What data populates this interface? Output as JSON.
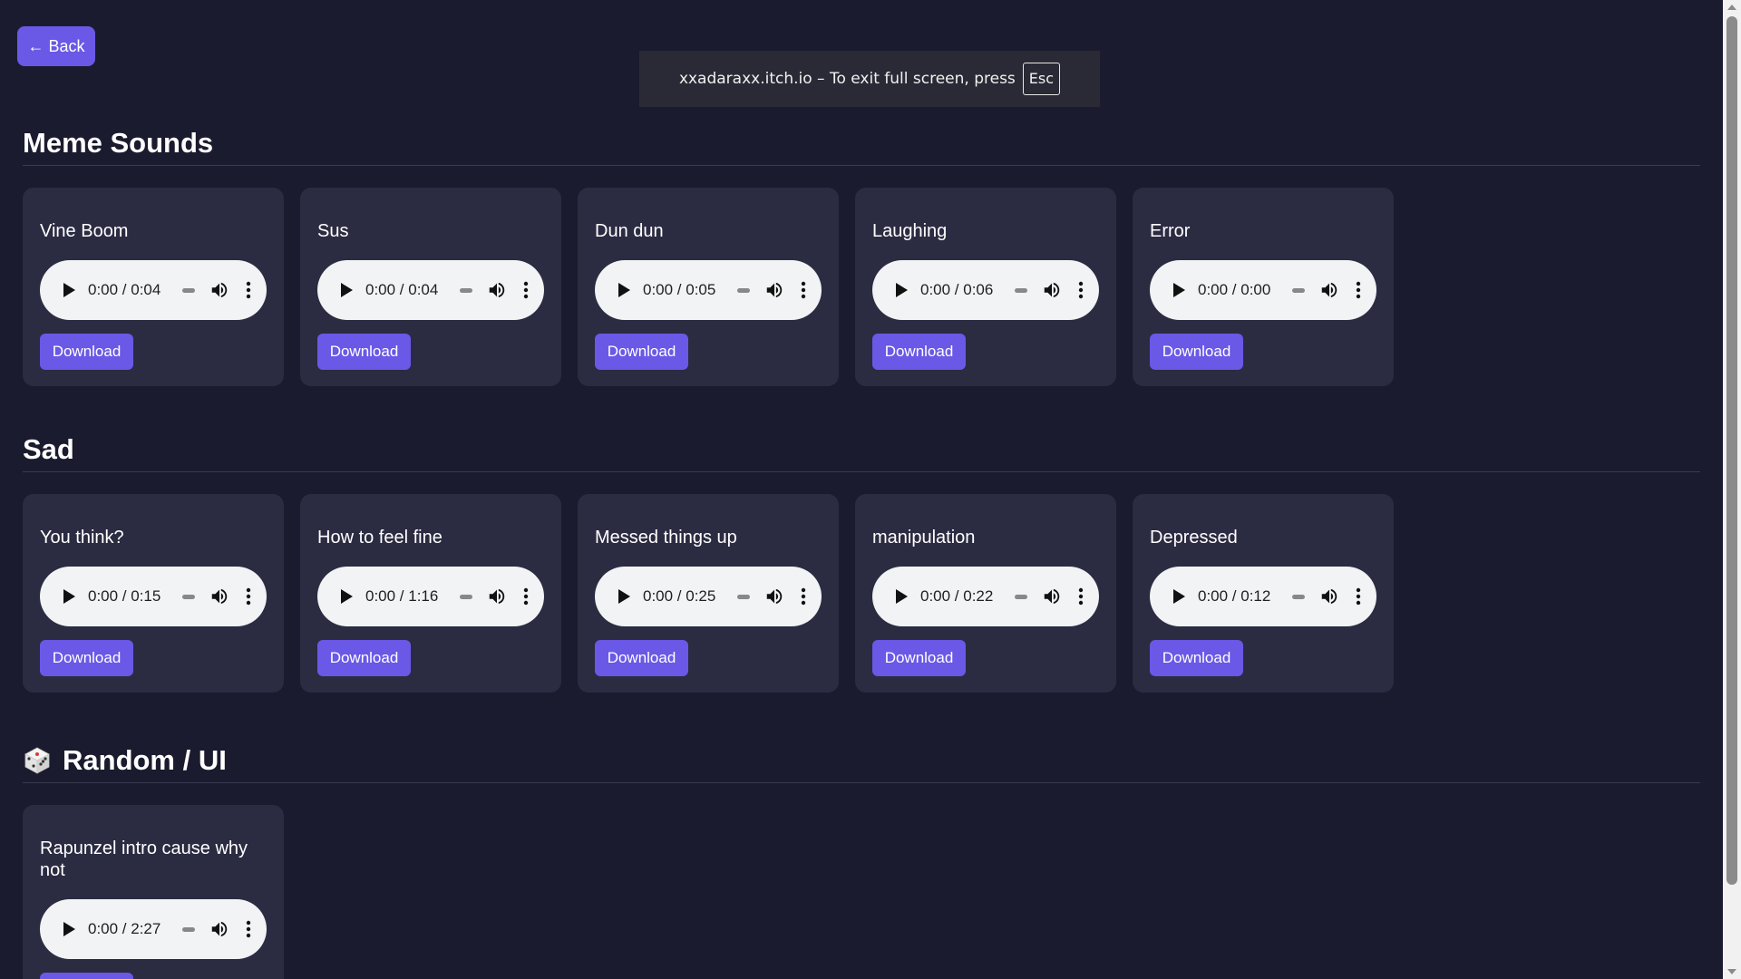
{
  "back_button": {
    "label": "← Back"
  },
  "fullscreen_notice": {
    "text": "xxadaraxx.itch.io – To exit full screen, press",
    "key": "Esc"
  },
  "colors": {
    "background": "#1b1b2f",
    "card": "#2b2b42",
    "accent": "#6a58e6",
    "player": "#f1f3f4"
  },
  "sections": [
    {
      "heading": "Meme Sounds",
      "icon": "",
      "sounds": [
        {
          "title": "Vine Boom",
          "time": "0:00 / 0:04",
          "download_label": "Download"
        },
        {
          "title": "Sus",
          "time": "0:00 / 0:04",
          "download_label": "Download"
        },
        {
          "title": "Dun dun",
          "time": "0:00 / 0:05",
          "download_label": "Download"
        },
        {
          "title": "Laughing",
          "time": "0:00 / 0:06",
          "download_label": "Download"
        },
        {
          "title": "Error",
          "time": "0:00 / 0:00",
          "download_label": "Download"
        }
      ]
    },
    {
      "heading": "Sad",
      "icon": "",
      "sounds": [
        {
          "title": "You think?",
          "time": "0:00 / 0:15",
          "download_label": "Download"
        },
        {
          "title": "How to feel fine",
          "time": "0:00 / 1:16",
          "download_label": "Download"
        },
        {
          "title": "Messed things up",
          "time": "0:00 / 0:25",
          "download_label": "Download"
        },
        {
          "title": "manipulation",
          "time": "0:00 / 0:22",
          "download_label": "Download"
        },
        {
          "title": "Depressed",
          "time": "0:00 / 0:12",
          "download_label": "Download"
        }
      ]
    },
    {
      "heading": "Random / UI",
      "icon": "dice-icon",
      "sounds": [
        {
          "title": "Rapunzel intro cause why not",
          "time": "0:00 / 2:27",
          "download_label": "Download"
        }
      ]
    }
  ]
}
